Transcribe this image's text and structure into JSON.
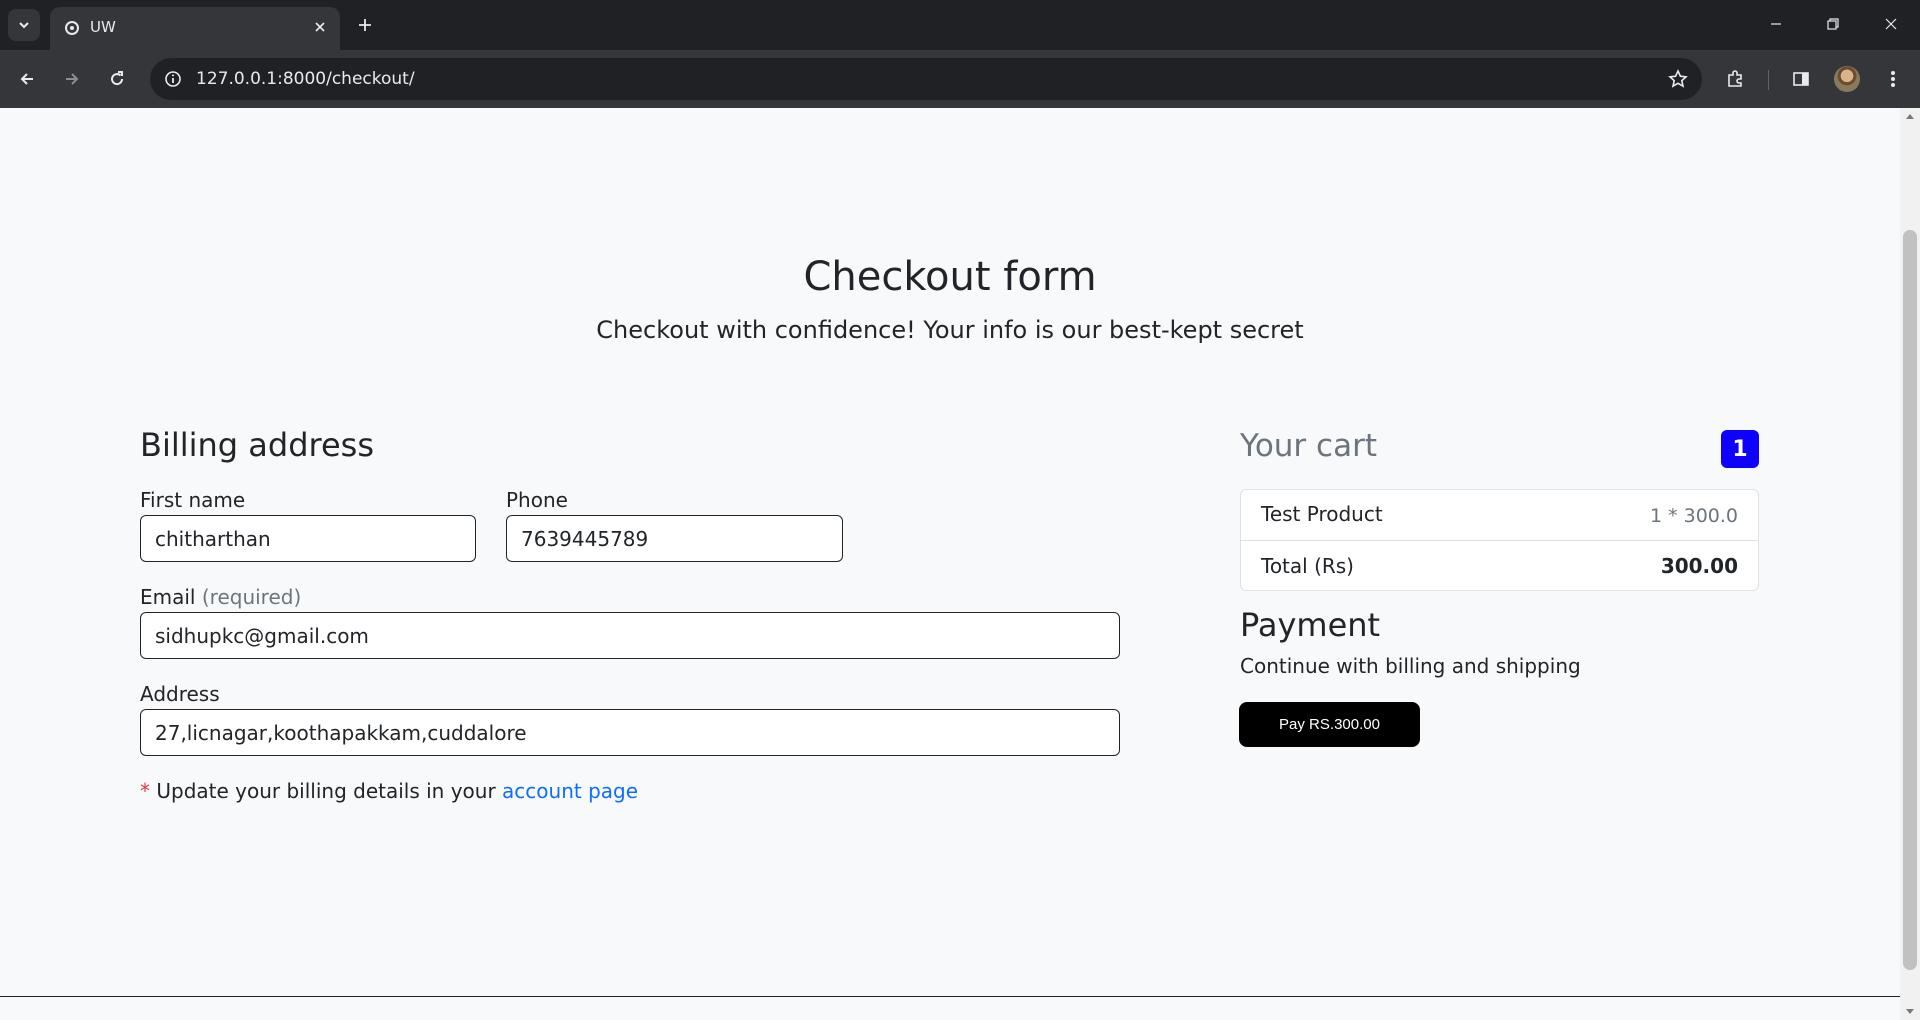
{
  "browser": {
    "tab_title": "UW",
    "url": "127.0.0.1:8000/checkout/",
    "icons": [
      "tab-search-icon",
      "favicon-icon",
      "close-icon",
      "plus-icon",
      "minimize-icon",
      "restore-icon",
      "close-window-icon",
      "back-icon",
      "forward-icon",
      "reload-icon",
      "info-icon",
      "star-icon",
      "extensions-icon",
      "side-panel-icon",
      "profile-avatar"
    ]
  },
  "header": {
    "title": "Checkout form",
    "subtitle": "Checkout with confidence! Your info is our best-kept secret"
  },
  "billing": {
    "heading": "Billing address",
    "first_name_label": "First name",
    "first_name_value": "chitharthan",
    "phone_label": "Phone",
    "phone_value": "7639445789",
    "email_label": "Email",
    "email_hint": "(required)",
    "email_value": "sidhupkc@gmail.com",
    "address_label": "Address",
    "address_value": "27,licnagar,koothapakkam,cuddalore",
    "note_star": "*",
    "note_text": "Update your billing details in your",
    "note_link": "account page"
  },
  "cart": {
    "heading": "Your cart",
    "count": "1",
    "items": [
      {
        "name": "Test Product",
        "qty_price": "1 * 300.0"
      }
    ],
    "total_label": "Total (Rs)",
    "total_value": "300.00"
  },
  "payment": {
    "heading": "Payment",
    "subtitle": "Continue with billing and shipping",
    "button_label": "Pay RS.300.00"
  },
  "colors": {
    "badge": "#0d00ff",
    "link": "#0d6efd",
    "required_star": "#dc3545",
    "pay_button": "#000000"
  }
}
